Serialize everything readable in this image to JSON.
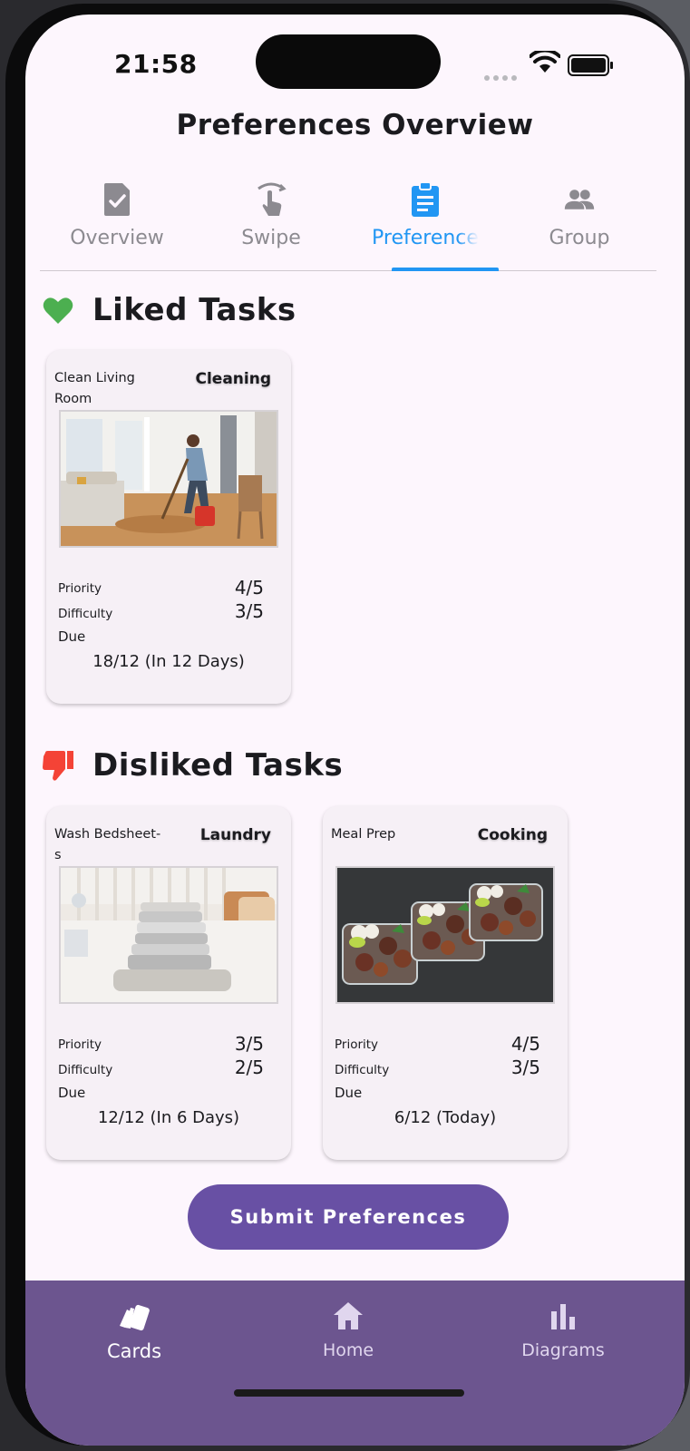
{
  "status_bar": {
    "time": "21:58"
  },
  "header": {
    "title": "Preferences Overview"
  },
  "tabs": [
    {
      "label": "Overview",
      "icon": "task-check-icon",
      "active": false
    },
    {
      "label": "Swipe",
      "icon": "swipe-gesture-icon",
      "active": false
    },
    {
      "label": "Preferences",
      "icon": "clipboard-list-icon",
      "active": true
    },
    {
      "label": "Group",
      "icon": "group-people-icon",
      "active": false
    }
  ],
  "liked": {
    "title": "Liked Tasks",
    "icon": "heart-icon",
    "icon_color": "#4caf50",
    "tasks": [
      {
        "name": "Clean Living Room",
        "category": "Cleaning",
        "image": "person-mopping-living-room",
        "priority_label": "Priority",
        "priority": "4/5",
        "difficulty_label": "Difficulty",
        "difficulty": "3/5",
        "due_label": "Due",
        "due": "18/12 (In 12 Days)"
      }
    ]
  },
  "disliked": {
    "title": "Disliked Tasks",
    "icon": "thumbs-down-icon",
    "icon_color": "#f44336",
    "tasks": [
      {
        "name": "Wash Bedsheet-s",
        "category": "Laundry",
        "image": "folded-bedsheets-stack",
        "priority_label": "Priority",
        "priority": "3/5",
        "difficulty_label": "Difficulty",
        "difficulty": "2/5",
        "due_label": "Due",
        "due": "12/12 (In 6 Days)"
      },
      {
        "name": "Meal Prep",
        "category": "Cooking",
        "image": "meal-prep-containers",
        "priority_label": "Priority",
        "priority": "4/5",
        "difficulty_label": "Difficulty",
        "difficulty": "3/5",
        "due_label": "Due",
        "due": "6/12 (Today)"
      }
    ]
  },
  "submit_label": "Submit Preferences",
  "bottom_nav": [
    {
      "label": "Cards",
      "icon": "cards-icon",
      "active": true
    },
    {
      "label": "Home",
      "icon": "home-icon",
      "active": false
    },
    {
      "label": "Diagrams",
      "icon": "bar-chart-icon",
      "active": false
    }
  ],
  "colors": {
    "accent": "#2196f3",
    "primary": "#6850a4",
    "nav_bg": "#6c558f",
    "background": "#fdf6fd"
  }
}
